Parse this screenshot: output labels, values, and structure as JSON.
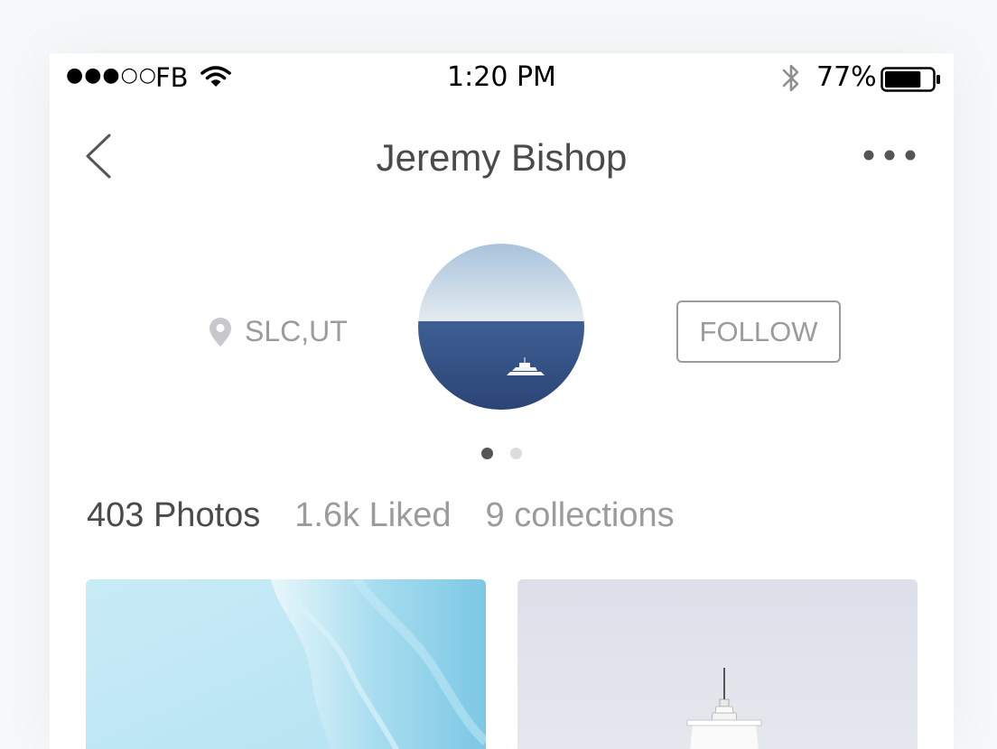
{
  "status_bar": {
    "signal": "●●●○○",
    "carrier": "FB",
    "time": "1:20 PM",
    "battery_percent": "77%",
    "battery_level": 0.77
  },
  "nav": {
    "title": "Jeremy Bishop",
    "back_icon": "chevron-left-icon",
    "more_icon": "more-icon"
  },
  "profile": {
    "location": "SLC,UT",
    "follow_label": "FOLLOW",
    "avatar_alt": "yacht-on-ocean",
    "pager_pages": 2,
    "pager_active": 1
  },
  "stats": {
    "photos": "403 Photos",
    "liked": "1.6k Liked",
    "collections": "9 collections"
  },
  "photos": [
    {
      "subject": "ice-wave"
    },
    {
      "subject": "lighthouse"
    }
  ],
  "colors": {
    "title_text": "#4a4a4a",
    "muted_text": "#9b9b9b",
    "active_dot": "#555555",
    "inactive_dot": "#dcdcdc"
  }
}
